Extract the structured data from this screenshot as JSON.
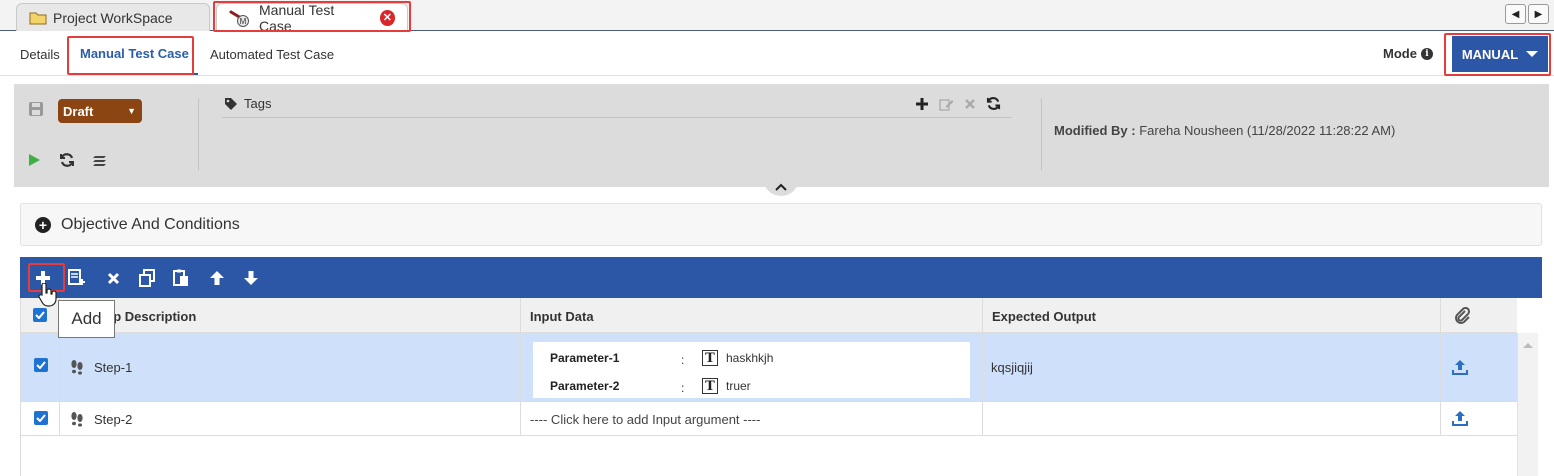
{
  "window_tabs": [
    {
      "label": "Project WorkSpace",
      "icon": "folder-icon"
    },
    {
      "label": "Manual Test Case",
      "icon": "manual-test-icon"
    }
  ],
  "sub_tabs": {
    "details": "Details",
    "manual": "Manual Test Case",
    "automated": "Automated Test Case"
  },
  "mode": {
    "label": "Mode",
    "value": "MANUAL"
  },
  "status": {
    "value": "Draft"
  },
  "tags": {
    "label": "Tags"
  },
  "modified": {
    "label": "Modified By :",
    "value": "Fareha Nousheen (11/28/2022 11:28:22 AM)"
  },
  "objective": {
    "label": "Objective And Conditions"
  },
  "tooltip": {
    "text": "Add"
  },
  "table": {
    "headers": {
      "step": "Step Description",
      "input": "Input Data",
      "output": "Expected Output"
    },
    "rows": [
      {
        "step": "Step-1",
        "params": [
          {
            "name": "Parameter-1",
            "sep": ":",
            "value": "haskhkjh"
          },
          {
            "name": "Parameter-2",
            "sep": ":",
            "value": "truer"
          }
        ],
        "output": "kqsjiqjij"
      },
      {
        "step": "Step-2",
        "input_placeholder": "---- Click here to add Input argument ----",
        "output": ""
      }
    ]
  },
  "colors": {
    "accent": "#2c56a6",
    "draft": "#8b4513",
    "highlight": "#e53c3c",
    "selected_row": "#cfe0fb",
    "close": "#d9262b"
  }
}
